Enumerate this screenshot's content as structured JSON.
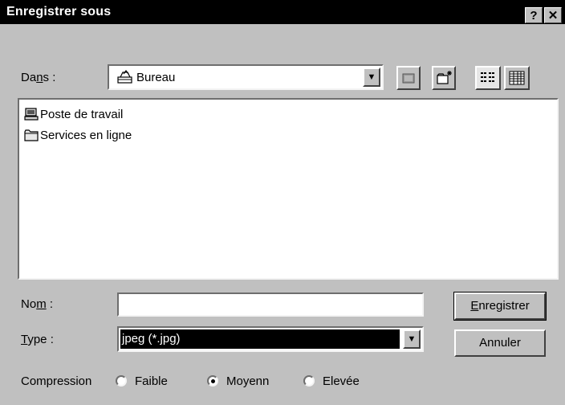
{
  "window": {
    "title": "Enregistrer sous",
    "help_label": "?",
    "close_label": "✕"
  },
  "location": {
    "label_pre": "Da",
    "label_acc": "n",
    "label_post": "s :",
    "value": "Bureau",
    "dropdown_arrow": "▼"
  },
  "toolbar": {
    "icons": [
      "up-folder-icon",
      "new-folder-icon",
      "list-view-icon",
      "details-view-icon"
    ]
  },
  "files": {
    "items": [
      {
        "label": "Poste de travail",
        "icon": "computer-icon"
      },
      {
        "label": "Services en ligne",
        "icon": "folder-icon"
      }
    ]
  },
  "filename": {
    "label_pre": "No",
    "label_acc": "m",
    "label_post": " :",
    "value": ""
  },
  "filetype": {
    "label_acc": "T",
    "label_post": "ype :",
    "value": "jpeg (*.jpg)",
    "dropdown_arrow": "▼"
  },
  "buttons": {
    "save_acc": "E",
    "save_post": "nregistrer",
    "cancel": "Annuler"
  },
  "compression": {
    "label": "Compression",
    "options": [
      {
        "label": "Faible",
        "selected": false
      },
      {
        "label": "Moyenn",
        "selected": true
      },
      {
        "label": "Elevée",
        "selected": false
      }
    ]
  }
}
